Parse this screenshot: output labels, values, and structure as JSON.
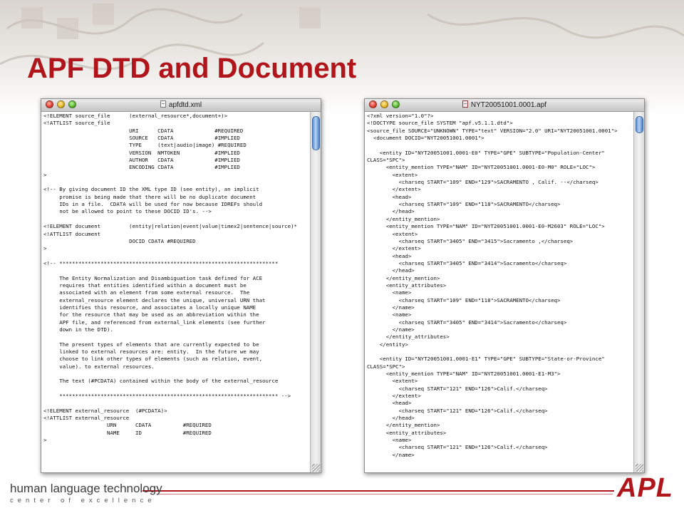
{
  "slide": {
    "title": "APF DTD and Document"
  },
  "left_window": {
    "title": "apfdtd.xml",
    "lines": [
      "<!ELEMENT source_file      (external_resource*,document+)>",
      "<!ATTLIST source_file",
      "                           URI      CDATA             #REQUIRED",
      "                           SOURCE   CDATA             #IMPLIED",
      "                           TYPE     (text|audio|image) #REQUIRED",
      "                           VERSION  NMTOKEN           #IMPLIED",
      "                           AUTHOR   CDATA             #IMPLIED",
      "                           ENCODING CDATA             #IMPLIED",
      ">",
      "",
      "<!-- By giving document ID the XML type ID (see entity), an implicit",
      "     promise is being made that there will be no duplicate document",
      "     IDs in a file.  CDATA will be used for now because IDREFs should",
      "     not be allowed to point to these DOCID ID's. -->",
      "",
      "<!ELEMENT document         (entity|relation|event|value|timex2|sentence|source)*",
      "<!ATTLIST document",
      "                           DOCID CDATA #REQUIRED",
      ">",
      "",
      "<!-- *********************************************************************",
      "",
      "     The Entity Normalization and Disambiguation task defined for ACE",
      "     requires that entities identified within a document must be",
      "     associated with an element from some external resource.  The",
      "     external_resource element declares the unique, universal URN that",
      "     identifies this resource, and associates a locally unique NAME",
      "     for the resource that may be used as an abbreviation within the",
      "     APF file, and referenced from external_link elements (see further",
      "     down in the DTD).",
      "",
      "     The present types of elements that are currently expected to be",
      "     linked to external resources are: entity.  In the future we may",
      "     choose to link other types of elements (such as relation, event,",
      "     value). to external resources.",
      "",
      "     The text (#PCDATA) contained within the body of the external_resource",
      "",
      "     ********************************************************************* -->",
      "",
      "<!ELEMENT external_resource  (#PCDATA)>",
      "<!ATTLIST external_resource",
      "                    URN      CDATA          #REQUIRED",
      "                    NAME     ID             #REQUIRED",
      ">"
    ]
  },
  "right_window": {
    "title": "NYT20051001.0001.apf",
    "lines": [
      "<?xml version=\"1.0\"?>",
      "<!DOCTYPE source_file SYSTEM \"apf.v5.1.1.dtd\">",
      "<source_file SOURCE=\"UNKNOWN\" TYPE=\"text\" VERSION=\"2.0\" URI=\"NYT20051001.0001\">",
      "  <document DOCID=\"NYT20051001.0001\">",
      "",
      "    <entity ID=\"NYT20051001.0001-E0\" TYPE=\"GPE\" SUBTYPE=\"Population-Center\"",
      "CLASS=\"SPC\">",
      "      <entity_mention TYPE=\"NAM\" ID=\"NYT20051001.0001-E0-M0\" ROLE=\"LOC\">",
      "        <extent>",
      "          <charseq START=\"109\" END=\"129\">SACRAMENTO , Calif. --</charseq>",
      "        </extent>",
      "        <head>",
      "          <charseq START=\"109\" END=\"118\">SACRAMENTO</charseq>",
      "        </head>",
      "      </entity_mention>",
      "      <entity_mention TYPE=\"NAM\" ID=\"NYT20051001.0001-E0-M2603\" ROLE=\"LOC\">",
      "        <extent>",
      "          <charseq START=\"3405\" END=\"3415\">Sacramento ,</charseq>",
      "        </extent>",
      "        <head>",
      "          <charseq START=\"3405\" END=\"3414\">Sacramento</charseq>",
      "        </head>",
      "      </entity_mention>",
      "      <entity_attributes>",
      "        <name>",
      "          <charseq START=\"109\" END=\"118\">SACRAMENTO</charseq>",
      "        </name>",
      "        <name>",
      "          <charseq START=\"3405\" END=\"3414\">Sacramento</charseq>",
      "        </name>",
      "      </entity_attributes>",
      "    </entity>",
      "",
      "    <entity ID=\"NYT20051001.0001-E1\" TYPE=\"GPE\" SUBTYPE=\"State-or-Province\"",
      "CLASS=\"SPC\">",
      "      <entity_mention TYPE=\"NAM\" ID=\"NYT20051001.0001-E1-M3\">",
      "        <extent>",
      "          <charseq START=\"121\" END=\"126\">Calif.</charseq>",
      "        </extent>",
      "        <head>",
      "          <charseq START=\"121\" END=\"126\">Calif.</charseq>",
      "        </head>",
      "      </entity_mention>",
      "      <entity_attributes>",
      "        <name>",
      "          <charseq START=\"121\" END=\"126\">Calif.</charseq>",
      "        </name>"
    ]
  },
  "footer": {
    "org_name": "human language technology",
    "org_tagline": "center of excellence",
    "logo_text": "APL"
  },
  "colors": {
    "accent": "#b1151c",
    "window_border": "#8c8c8c"
  }
}
